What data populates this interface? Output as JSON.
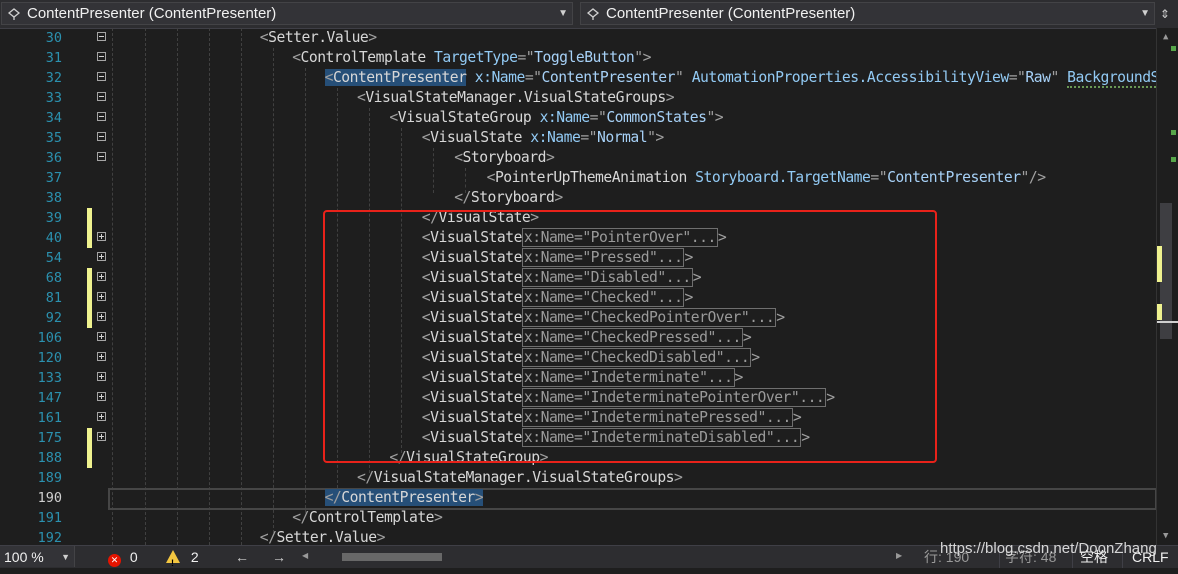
{
  "nav": {
    "left_combo": "ContentPresenter (ContentPresenter)",
    "right_combo": "ContentPresenter (ContentPresenter)"
  },
  "lines": [
    {
      "num": "30",
      "fold": "minus",
      "change": false,
      "indent": 9,
      "tokens": [
        {
          "t": "punc",
          "v": "<"
        },
        {
          "t": "el",
          "v": "Setter.Value"
        },
        {
          "t": "punc",
          "v": ">"
        }
      ]
    },
    {
      "num": "31",
      "fold": "minus",
      "change": false,
      "indent": 11,
      "tokens": [
        {
          "t": "punc",
          "v": "<"
        },
        {
          "t": "el",
          "v": "ControlTemplate "
        },
        {
          "t": "attr",
          "v": "TargetType"
        },
        {
          "t": "punc",
          "v": "=\""
        },
        {
          "t": "str",
          "v": "ToggleButton"
        },
        {
          "t": "punc",
          "v": "\">"
        }
      ]
    },
    {
      "num": "32",
      "fold": "minus",
      "change": false,
      "indent": 13,
      "tokens": [
        {
          "t": "punc sel",
          "v": "<"
        },
        {
          "t": "el sel",
          "v": "ContentPresenter"
        },
        {
          "t": "el",
          "v": " "
        },
        {
          "t": "attr",
          "v": "x:Name"
        },
        {
          "t": "punc",
          "v": "=\""
        },
        {
          "t": "str",
          "v": "ContentPresenter"
        },
        {
          "t": "punc",
          "v": "\" "
        },
        {
          "t": "attr",
          "v": "AutomationProperties.AccessibilityView"
        },
        {
          "t": "punc",
          "v": "=\""
        },
        {
          "t": "str",
          "v": "Raw"
        },
        {
          "t": "punc",
          "v": "\" "
        },
        {
          "t": "attr squiggle",
          "v": "BackgroundSizi"
        }
      ]
    },
    {
      "num": "33",
      "fold": "minus",
      "change": false,
      "indent": 15,
      "tokens": [
        {
          "t": "punc",
          "v": "<"
        },
        {
          "t": "el",
          "v": "VisualStateManager.VisualStateGroups"
        },
        {
          "t": "punc",
          "v": ">"
        }
      ]
    },
    {
      "num": "34",
      "fold": "minus",
      "change": false,
      "indent": 17,
      "tokens": [
        {
          "t": "punc",
          "v": "<"
        },
        {
          "t": "el",
          "v": "VisualStateGroup "
        },
        {
          "t": "attr",
          "v": "x:Name"
        },
        {
          "t": "punc",
          "v": "=\""
        },
        {
          "t": "str",
          "v": "CommonStates"
        },
        {
          "t": "punc",
          "v": "\">"
        }
      ]
    },
    {
      "num": "35",
      "fold": "minus",
      "change": false,
      "indent": 19,
      "tokens": [
        {
          "t": "punc",
          "v": "<"
        },
        {
          "t": "el",
          "v": "VisualState "
        },
        {
          "t": "attr",
          "v": "x:Name"
        },
        {
          "t": "punc",
          "v": "=\""
        },
        {
          "t": "str",
          "v": "Normal"
        },
        {
          "t": "punc",
          "v": "\">"
        }
      ]
    },
    {
      "num": "36",
      "fold": "minus",
      "change": false,
      "indent": 21,
      "tokens": [
        {
          "t": "punc",
          "v": "<"
        },
        {
          "t": "el",
          "v": "Storyboard"
        },
        {
          "t": "punc",
          "v": ">"
        }
      ]
    },
    {
      "num": "37",
      "fold": "none",
      "change": false,
      "indent": 23,
      "tokens": [
        {
          "t": "punc",
          "v": "<"
        },
        {
          "t": "el",
          "v": "PointerUpThemeAnimation "
        },
        {
          "t": "attr",
          "v": "Storyboard.TargetName"
        },
        {
          "t": "punc",
          "v": "=\""
        },
        {
          "t": "str",
          "v": "ContentPresenter"
        },
        {
          "t": "punc",
          "v": "\"/>"
        }
      ]
    },
    {
      "num": "38",
      "fold": "none",
      "change": false,
      "indent": 21,
      "tokens": [
        {
          "t": "punc",
          "v": "</"
        },
        {
          "t": "el",
          "v": "Storyboard"
        },
        {
          "t": "punc",
          "v": ">"
        }
      ]
    },
    {
      "num": "39",
      "fold": "none",
      "change": true,
      "indent": 19,
      "tokens": [
        {
          "t": "punc",
          "v": "</"
        },
        {
          "t": "el",
          "v": "VisualState"
        },
        {
          "t": "punc",
          "v": ">"
        }
      ]
    },
    {
      "num": "40",
      "fold": "plus",
      "change": true,
      "indent": 19,
      "tokens": [
        {
          "t": "punc",
          "v": "<"
        },
        {
          "t": "el",
          "v": "VisualState"
        },
        {
          "t": "collapsed",
          "v": "x:Name=\"PointerOver\"..."
        },
        {
          "t": "punc",
          "v": ">"
        }
      ]
    },
    {
      "num": "54",
      "fold": "plus",
      "change": false,
      "indent": 19,
      "tokens": [
        {
          "t": "punc",
          "v": "<"
        },
        {
          "t": "el",
          "v": "VisualState"
        },
        {
          "t": "collapsed",
          "v": "x:Name=\"Pressed\"..."
        },
        {
          "t": "punc",
          "v": ">"
        }
      ]
    },
    {
      "num": "68",
      "fold": "plus",
      "change": true,
      "indent": 19,
      "tokens": [
        {
          "t": "punc",
          "v": "<"
        },
        {
          "t": "el",
          "v": "VisualState"
        },
        {
          "t": "collapsed",
          "v": "x:Name=\"Disabled\"..."
        },
        {
          "t": "punc",
          "v": ">"
        }
      ]
    },
    {
      "num": "81",
      "fold": "plus",
      "change": true,
      "indent": 19,
      "tokens": [
        {
          "t": "punc",
          "v": "<"
        },
        {
          "t": "el",
          "v": "VisualState"
        },
        {
          "t": "collapsed",
          "v": "x:Name=\"Checked\"..."
        },
        {
          "t": "punc",
          "v": ">"
        }
      ]
    },
    {
      "num": "92",
      "fold": "plus",
      "change": true,
      "indent": 19,
      "tokens": [
        {
          "t": "punc",
          "v": "<"
        },
        {
          "t": "el",
          "v": "VisualState"
        },
        {
          "t": "collapsed",
          "v": "x:Name=\"CheckedPointerOver\"..."
        },
        {
          "t": "punc",
          "v": ">"
        }
      ]
    },
    {
      "num": "106",
      "fold": "plus",
      "change": false,
      "indent": 19,
      "tokens": [
        {
          "t": "punc",
          "v": "<"
        },
        {
          "t": "el",
          "v": "VisualState"
        },
        {
          "t": "collapsed",
          "v": "x:Name=\"CheckedPressed\"..."
        },
        {
          "t": "punc",
          "v": ">"
        }
      ]
    },
    {
      "num": "120",
      "fold": "plus",
      "change": false,
      "indent": 19,
      "tokens": [
        {
          "t": "punc",
          "v": "<"
        },
        {
          "t": "el",
          "v": "VisualState"
        },
        {
          "t": "collapsed",
          "v": "x:Name=\"CheckedDisabled\"..."
        },
        {
          "t": "punc",
          "v": ">"
        }
      ]
    },
    {
      "num": "133",
      "fold": "plus",
      "change": false,
      "indent": 19,
      "tokens": [
        {
          "t": "punc",
          "v": "<"
        },
        {
          "t": "el",
          "v": "VisualState"
        },
        {
          "t": "collapsed",
          "v": "x:Name=\"Indeterminate\"..."
        },
        {
          "t": "punc",
          "v": ">"
        }
      ]
    },
    {
      "num": "147",
      "fold": "plus",
      "change": false,
      "indent": 19,
      "tokens": [
        {
          "t": "punc",
          "v": "<"
        },
        {
          "t": "el",
          "v": "VisualState"
        },
        {
          "t": "collapsed",
          "v": "x:Name=\"IndeterminatePointerOver\"..."
        },
        {
          "t": "punc",
          "v": ">"
        }
      ]
    },
    {
      "num": "161",
      "fold": "plus",
      "change": false,
      "indent": 19,
      "tokens": [
        {
          "t": "punc",
          "v": "<"
        },
        {
          "t": "el",
          "v": "VisualState"
        },
        {
          "t": "collapsed",
          "v": "x:Name=\"IndeterminatePressed\"..."
        },
        {
          "t": "punc",
          "v": ">"
        }
      ]
    },
    {
      "num": "175",
      "fold": "plus",
      "change": true,
      "indent": 19,
      "tokens": [
        {
          "t": "punc",
          "v": "<"
        },
        {
          "t": "el",
          "v": "VisualState"
        },
        {
          "t": "collapsed",
          "v": "x:Name=\"IndeterminateDisabled\"..."
        },
        {
          "t": "punc",
          "v": ">"
        }
      ]
    },
    {
      "num": "188",
      "fold": "none",
      "change": true,
      "indent": 17,
      "tokens": [
        {
          "t": "punc",
          "v": "</"
        },
        {
          "t": "el",
          "v": "VisualStateGroup"
        },
        {
          "t": "punc",
          "v": ">"
        }
      ]
    },
    {
      "num": "189",
      "fold": "none",
      "change": false,
      "indent": 15,
      "tokens": [
        {
          "t": "punc",
          "v": "</"
        },
        {
          "t": "el",
          "v": "VisualStateManager.VisualStateGroups"
        },
        {
          "t": "punc",
          "v": ">"
        }
      ]
    },
    {
      "num": "190",
      "fold": "none",
      "change": false,
      "current": true,
      "indent": 13,
      "tokens": [
        {
          "t": "punc sel",
          "v": "</"
        },
        {
          "t": "el sel",
          "v": "ContentPresenter"
        },
        {
          "t": "punc sel",
          "v": ">"
        }
      ]
    },
    {
      "num": "191",
      "fold": "none",
      "change": false,
      "indent": 11,
      "tokens": [
        {
          "t": "punc",
          "v": "</"
        },
        {
          "t": "el",
          "v": "ControlTemplate"
        },
        {
          "t": "punc",
          "v": ">"
        }
      ]
    },
    {
      "num": "192",
      "fold": "none",
      "change": false,
      "indent": 9,
      "tokens": [
        {
          "t": "punc",
          "v": "</"
        },
        {
          "t": "el",
          "v": "Setter.Value"
        },
        {
          "t": "punc",
          "v": ">"
        }
      ]
    }
  ],
  "status": {
    "zoom": "100 %",
    "errors": "0",
    "warnings": "2",
    "watermark": "https://blog.csdn.net/DoonZhang",
    "line": "行: 190",
    "chars": "字符: 48",
    "whitespace": "空格",
    "line_ending": "CRLF"
  },
  "colors": {
    "background": "#1e1e1e",
    "highlight_box": "#e8221a",
    "selection": "#264f78",
    "change_marker": "#eff28f"
  }
}
